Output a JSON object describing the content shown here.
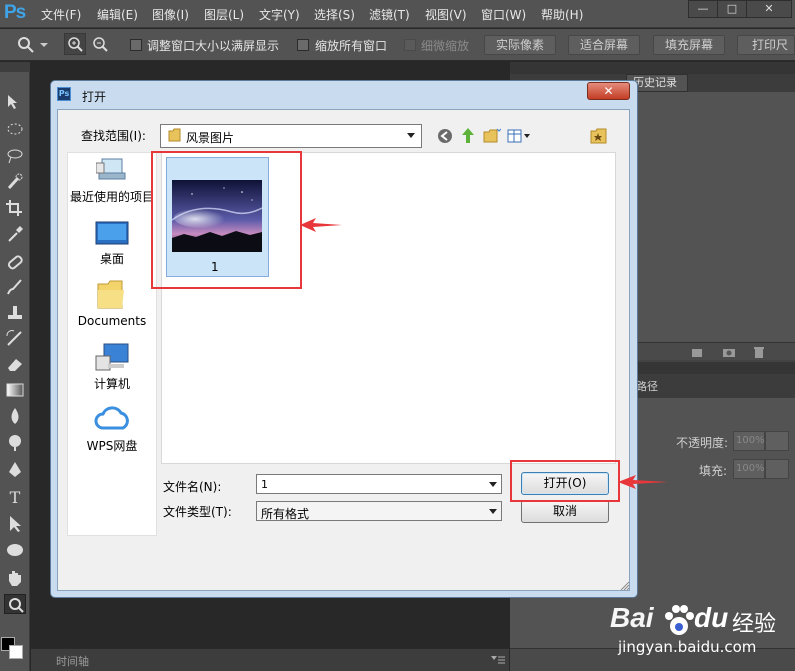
{
  "app": {
    "logo": "Ps"
  },
  "menubar": {
    "items": [
      "文件(F)",
      "编辑(E)",
      "图像(I)",
      "图层(L)",
      "文字(Y)",
      "选择(S)",
      "滤镜(T)",
      "视图(V)",
      "窗口(W)",
      "帮助(H)"
    ]
  },
  "window_controls": {
    "minimize": "—",
    "maximize": "□",
    "close": "✕"
  },
  "optionsbar": {
    "resize_windows": "调整窗口大小以满屏显示",
    "zoom_all": "缩放所有窗口",
    "scrubby_zoom": "细微缩放",
    "actual_pixels": "实际像素",
    "fit_screen": "适合屏幕",
    "fill_screen": "填充屏幕",
    "print_size": "打印尺"
  },
  "panels": {
    "history_tab": "历史记录",
    "paths_tab": "路径",
    "opacity_label": "不透明度:",
    "opacity_value": "100%",
    "fill_label": "填充:",
    "fill_value": "100%",
    "timeline_tab": "时间轴"
  },
  "dialog": {
    "title": "打开",
    "close": "✕",
    "lookin_label": "查找范围(I):",
    "lookin_value": "风景图片",
    "places": [
      "最近使用的项目",
      "桌面",
      "Documents",
      "计算机",
      "WPS网盘"
    ],
    "file_name": "1",
    "filename_label": "文件名(N):",
    "filename_value": "1",
    "filetype_label": "文件类型(T):",
    "filetype_value": "所有格式",
    "open_button": "打开(O)",
    "cancel_button": "取消"
  },
  "watermark": {
    "brand": "Bai",
    "brand2": "du",
    "brand3": "经验",
    "url": "jingyan.baidu.com"
  },
  "colors": {
    "highlight": "#e8373a",
    "ps_blue": "#3fa3e8",
    "dialog_frame": "#c9dcef",
    "close_red": "#c43d25"
  }
}
